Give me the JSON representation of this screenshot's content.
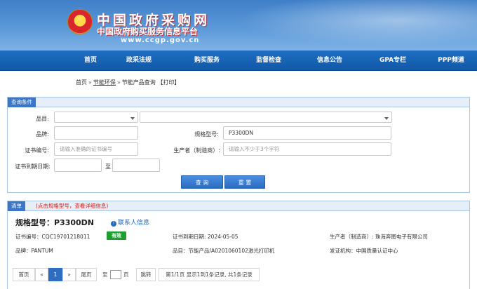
{
  "site": {
    "title": "中国政府采购网",
    "subtitle": "中国政府购买服务信息平台",
    "url": "www.ccgp.gov.cn"
  },
  "nav": [
    "首页",
    "政采法规",
    "购买服务",
    "监督检查",
    "信息公告",
    "GPA专栏",
    "PPP频道"
  ],
  "breadcrumb": {
    "home": "首页",
    "sep": "»",
    "energy": "节能环保",
    "query": "节能产品查询",
    "print": "【打印】"
  },
  "query": {
    "panel_title": "查询条件",
    "product_label": "品目:",
    "product_value": "",
    "product_sub_value": "",
    "brand_label": "品牌:",
    "brand_value": "",
    "model_label": "规格型号:",
    "model_value": "P3300DN",
    "cert_label": "证书编号:",
    "cert_placeholder": "请输入准确的证书编号",
    "maker_label": "生产者（制造商）:",
    "maker_placeholder": "请输入不少于3个字符",
    "expiry_label": "证书到期日期:",
    "expiry_from": "",
    "expiry_to_label": "至",
    "expiry_to": "",
    "search_button": "查 询",
    "reset_button": "重 置"
  },
  "result": {
    "panel_title": "清单",
    "hint": "(点击规格型号，查看详细信息)",
    "model": "规格型号：P3300DN",
    "contact": "联系人信息",
    "cert_no": "证书编号：CQC19701218011",
    "status": "有效",
    "expiry": "证书到期日期: 2024-05-05",
    "maker": "生产者（制造商）: 珠海奔图电子有限公司",
    "brand": "品牌：PANTUM",
    "product": "品目：节能产品/A0201060102激光打印机",
    "issuer": "发证机构：中国质量认证中心"
  },
  "pager": {
    "first": "首页",
    "prev": "«",
    "current": "1",
    "next": "»",
    "last": "尾页",
    "to_label": "至",
    "page_unit": "页",
    "jump": "跳转",
    "summary": "第1/1页  显示1到1条记录, 共1条记录"
  },
  "colors": {
    "header_blue": "#3f7fc8",
    "nav_blue": "#1158a8",
    "button_blue": "#2c6cc0",
    "hint_red": "#d0201b",
    "status_green": "#1e9e2f"
  }
}
